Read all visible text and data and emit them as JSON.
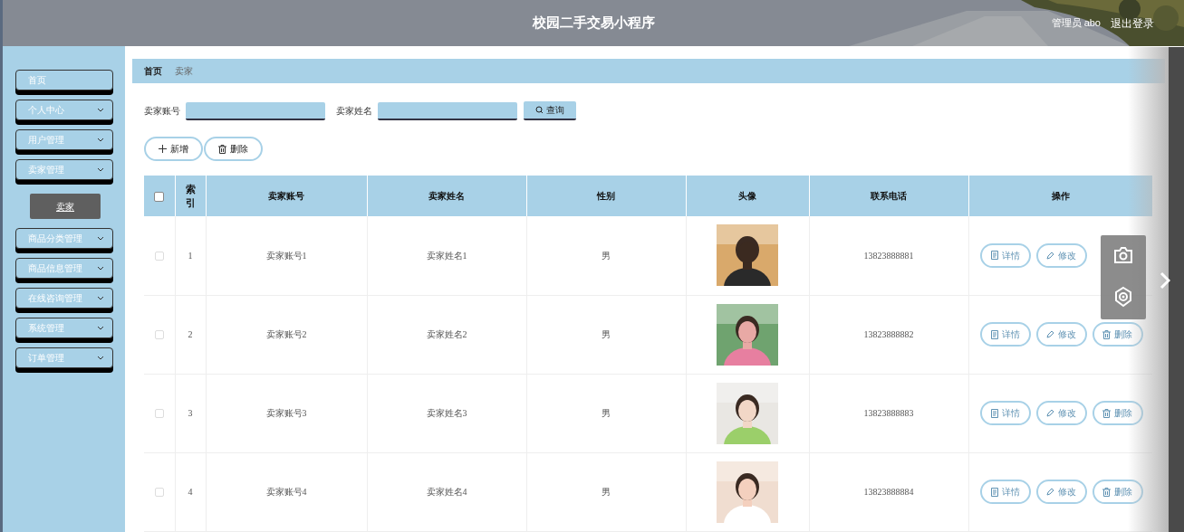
{
  "header": {
    "title": "校园二手交易小程序",
    "user": "管理员 abo",
    "logout": "退出登录"
  },
  "sidebar": {
    "items": [
      {
        "label": "首页",
        "expandable": false,
        "expanded": false
      },
      {
        "label": "个人中心",
        "expandable": true,
        "expanded": false
      },
      {
        "label": "用户管理",
        "expandable": true,
        "expanded": false
      },
      {
        "label": "卖家管理",
        "expandable": true,
        "expanded": true,
        "children": [
          {
            "label": "卖家",
            "selected": true
          }
        ]
      },
      {
        "label": "商品分类管理",
        "expandable": true,
        "expanded": false
      },
      {
        "label": "商品信息管理",
        "expandable": true,
        "expanded": false
      },
      {
        "label": "在线咨询管理",
        "expandable": true,
        "expanded": false
      },
      {
        "label": "系统管理",
        "expandable": true,
        "expanded": false
      },
      {
        "label": "订单管理",
        "expandable": true,
        "expanded": false
      }
    ]
  },
  "breadcrumb": [
    "首页",
    "卖家"
  ],
  "search": {
    "fields": [
      {
        "label": "卖家账号"
      },
      {
        "label": "卖家姓名"
      }
    ],
    "button": "查询"
  },
  "actions": [
    {
      "kind": "add",
      "label": "新增"
    },
    {
      "kind": "delete",
      "label": "删除"
    }
  ],
  "table": {
    "select_all": {
      "checked": false
    },
    "columns": [
      "索引",
      "卖家账号",
      "卖家姓名",
      "性别",
      "头像",
      "联系电话",
      "操作"
    ],
    "rows": [
      {
        "checked": false,
        "index": "1",
        "account": "卖家账号1",
        "name": "卖家姓名1",
        "gender": "男",
        "avatar": {
          "kind": "picture"
        },
        "phone": "13823888881",
        "ops": [
          {
            "kind": "detail",
            "label": "详情"
          },
          {
            "kind": "edit",
            "label": "修改"
          }
        ]
      },
      {
        "checked": false,
        "index": "2",
        "account": "卖家账号2",
        "name": "卖家姓名2",
        "gender": "男",
        "avatar": {
          "kind": "picture"
        },
        "phone": "13823888882",
        "ops": [
          {
            "kind": "detail",
            "label": "详情"
          },
          {
            "kind": "edit",
            "label": "修改"
          },
          {
            "kind": "delete",
            "label": "删除"
          }
        ]
      },
      {
        "checked": false,
        "index": "3",
        "account": "卖家账号3",
        "name": "卖家姓名3",
        "gender": "男",
        "avatar": {
          "kind": "picture"
        },
        "phone": "13823888883",
        "ops": [
          {
            "kind": "detail",
            "label": "详情"
          },
          {
            "kind": "edit",
            "label": "修改"
          },
          {
            "kind": "delete",
            "label": "删除"
          }
        ]
      },
      {
        "checked": false,
        "index": "4",
        "account": "卖家账号4",
        "name": "卖家姓名4",
        "gender": "男",
        "avatar": {
          "kind": "picture"
        },
        "phone": "13823888884",
        "ops": [
          {
            "kind": "detail",
            "label": "详情"
          },
          {
            "kind": "edit",
            "label": "修改"
          },
          {
            "kind": "delete",
            "label": "删除"
          }
        ]
      }
    ]
  }
}
